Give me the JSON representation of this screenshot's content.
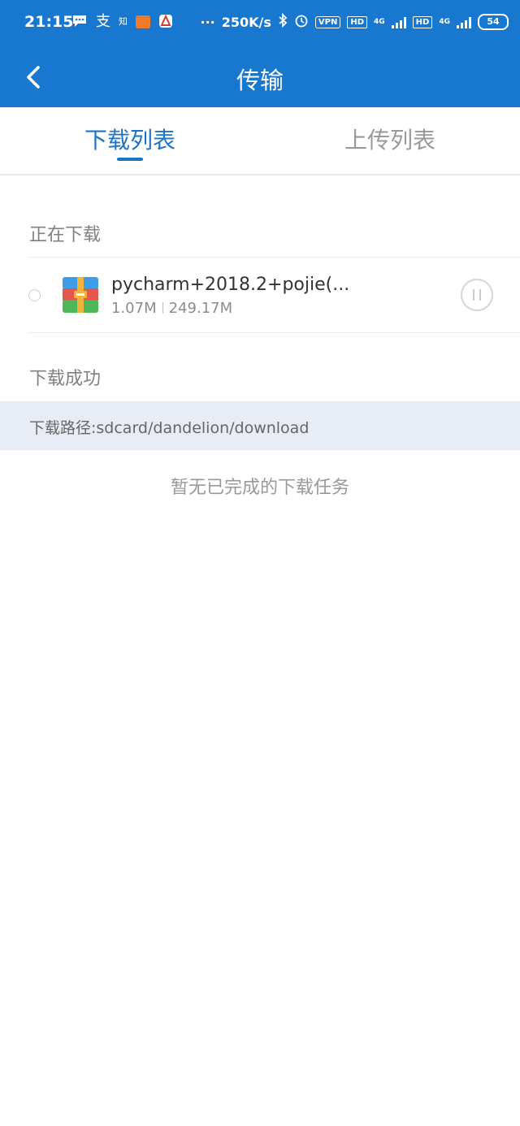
{
  "status_bar": {
    "time": "21:15",
    "app_icons": [
      "message-icon",
      "alipay-icon",
      "zhihu-icon",
      "taobao-icon",
      "app-a-icon"
    ],
    "alipay_glyph": "支",
    "zhihu_glyph": "知",
    "more": "···",
    "network_speed": "250K/s",
    "vpn": "VPN",
    "hd1": "HD",
    "net1": "4G",
    "hd2": "HD",
    "net2": "4G",
    "battery": "54"
  },
  "app_bar": {
    "title": "传输",
    "back_icon": "chevron-left-icon"
  },
  "tabs": [
    {
      "label": "下载列表",
      "active": true
    },
    {
      "label": "上传列表",
      "active": false
    }
  ],
  "downloading": {
    "section_title": "正在下载",
    "items": [
      {
        "name": "pycharm+2018.2+pojie(...",
        "downloaded": "1.07M",
        "total": "249.17M",
        "progress": 0.0043,
        "file_icon": "archive-icon",
        "action_icon": "pause-icon"
      }
    ]
  },
  "completed": {
    "section_title": "下载成功",
    "path_label": "下载路径:",
    "path_value": "sdcard/dandelion/download",
    "empty_text": "暂无已完成的下载任务"
  },
  "colors": {
    "primary": "#1878cf",
    "tab_active": "#1b74c5",
    "path_bar_bg": "#e8ecf4"
  }
}
